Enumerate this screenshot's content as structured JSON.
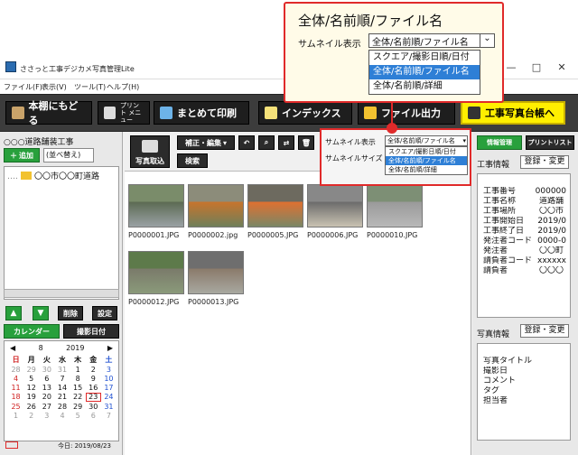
{
  "app": {
    "title": "ささっと工事デジカメ写真管理Lite"
  },
  "window_controls": {
    "min": "—",
    "max": "□",
    "close": "✕"
  },
  "menubar": [
    "ファイル(F)",
    "表示(V)",
    "ツール(T)",
    "ヘルプ(H)"
  ],
  "toolbar": {
    "back": "本棚にもどる",
    "print_menu": "プリント メニュー",
    "batch_print": "まとめて印刷",
    "index": "インデックス",
    "file_output": "ファイル出力",
    "ledger": "工事写真台帳へ"
  },
  "left_panel": {
    "project_title": "○○○道路舗装工事",
    "add_button": "追加",
    "sort_select": "(並べ替え)",
    "tree_item": "〇〇市〇〇町道路",
    "delete_button": "削除",
    "settings_button": "設定",
    "tab_calendar": "カレンダー",
    "tab_date": "撮影日付",
    "calendar": {
      "month": "8",
      "year": "2019",
      "weekdays": [
        "日",
        "月",
        "火",
        "水",
        "木",
        "金",
        "土"
      ],
      "days": [
        "28",
        "29",
        "30",
        "31",
        "1",
        "2",
        "3",
        "4",
        "5",
        "6",
        "7",
        "8",
        "9",
        "10",
        "11",
        "12",
        "13",
        "14",
        "15",
        "16",
        "17",
        "18",
        "19",
        "20",
        "21",
        "22",
        "23",
        "24",
        "25",
        "26",
        "27",
        "28",
        "29",
        "30",
        "31",
        "1",
        "2",
        "3",
        "4",
        "5",
        "6",
        "7"
      ],
      "selected": "23",
      "today_label": "今日: 2019/08/23"
    }
  },
  "center_panel": {
    "import_button": "写真取込",
    "edit_menu": "補正・編集",
    "search_button": "検索",
    "photos": [
      {
        "name": "P0000001.JPG"
      },
      {
        "name": "P0000002.jpg"
      },
      {
        "name": "P0000005.JPG"
      },
      {
        "name": "P0000006.JPG"
      },
      {
        "name": "P0000010.JPG"
      },
      {
        "name": "P0000012.JPG"
      },
      {
        "name": "P0000013.JPG"
      }
    ]
  },
  "thumbnail_settings": {
    "display_label": "サムネイル表示",
    "size_label": "サムネイルサイズ",
    "current": "全体/名前順/ファイル名",
    "options": [
      "スクエア/撮影日順/日付",
      "全体/名前順/ファイル名",
      "全体/名前順/詳細"
    ],
    "selected_index": 1
  },
  "callout": {
    "title": "全体/名前順/ファイル名",
    "label": "サムネイル表示",
    "current": "全体/名前順/ファイル名",
    "options": [
      "スクエア/撮影日順/日付",
      "全体/名前順/ファイル名",
      "全体/名前順/詳細"
    ],
    "selected_index": 1
  },
  "right_panel": {
    "tab_info": "情報管理",
    "tab_print": "プリントリスト",
    "work_info_title": "工事情報",
    "register_button": "登録・変更",
    "work_rows": [
      {
        "label": "工事番号",
        "value": "000000"
      },
      {
        "label": "工事名称",
        "value": "道路舗"
      },
      {
        "label": "工事場所",
        "value": "〇〇市"
      },
      {
        "label": "工事開始日",
        "value": "2019/0"
      },
      {
        "label": "工事終了日",
        "value": "2019/0"
      },
      {
        "label": "発注者コード",
        "value": "0000-0"
      },
      {
        "label": "発注者",
        "value": "〇〇町"
      },
      {
        "label": "請負者コード",
        "value": "xxxxxx"
      },
      {
        "label": "請負者",
        "value": "〇〇〇"
      }
    ],
    "photo_info_title": "写真情報",
    "photo_register_button": "登録・変更",
    "photo_rows": [
      "写真タイトル",
      "撮影日",
      "コメント",
      "タグ",
      "担当者"
    ]
  }
}
